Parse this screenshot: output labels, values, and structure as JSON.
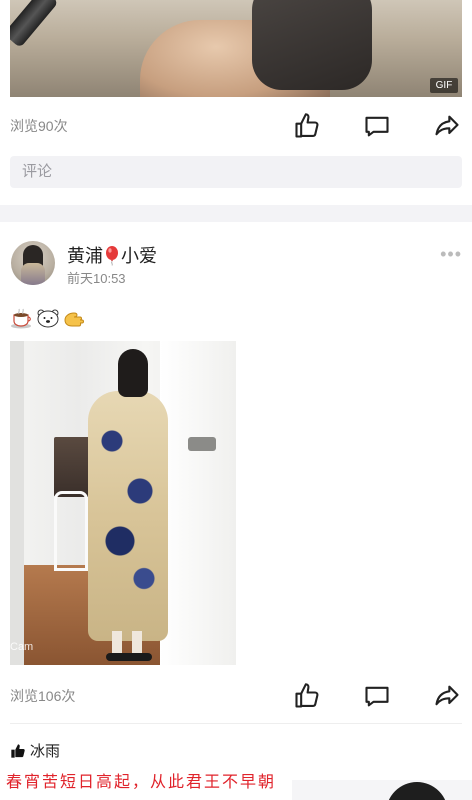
{
  "top_post": {
    "media_badge": "GIF",
    "views": "浏览90次",
    "comment_placeholder": "评论"
  },
  "post": {
    "username_part1": "黄浦",
    "username_part2": "小爱",
    "time": "前天10:53",
    "more": "•••",
    "photo_watermark": "Cam",
    "views": "浏览106次",
    "liked_by": "冰雨"
  },
  "overlay_caption": "春宵苦短日高起，从此君王不早朝",
  "icons": {
    "like": "thumbs-up-icon",
    "comment": "comment-icon",
    "share": "share-icon",
    "balloon": "balloon-icon",
    "liked": "thumbs-up-filled-icon"
  },
  "colors": {
    "accent_red": "#e0232b",
    "muted_text": "#888888",
    "section_bg": "#f3f3f6"
  }
}
